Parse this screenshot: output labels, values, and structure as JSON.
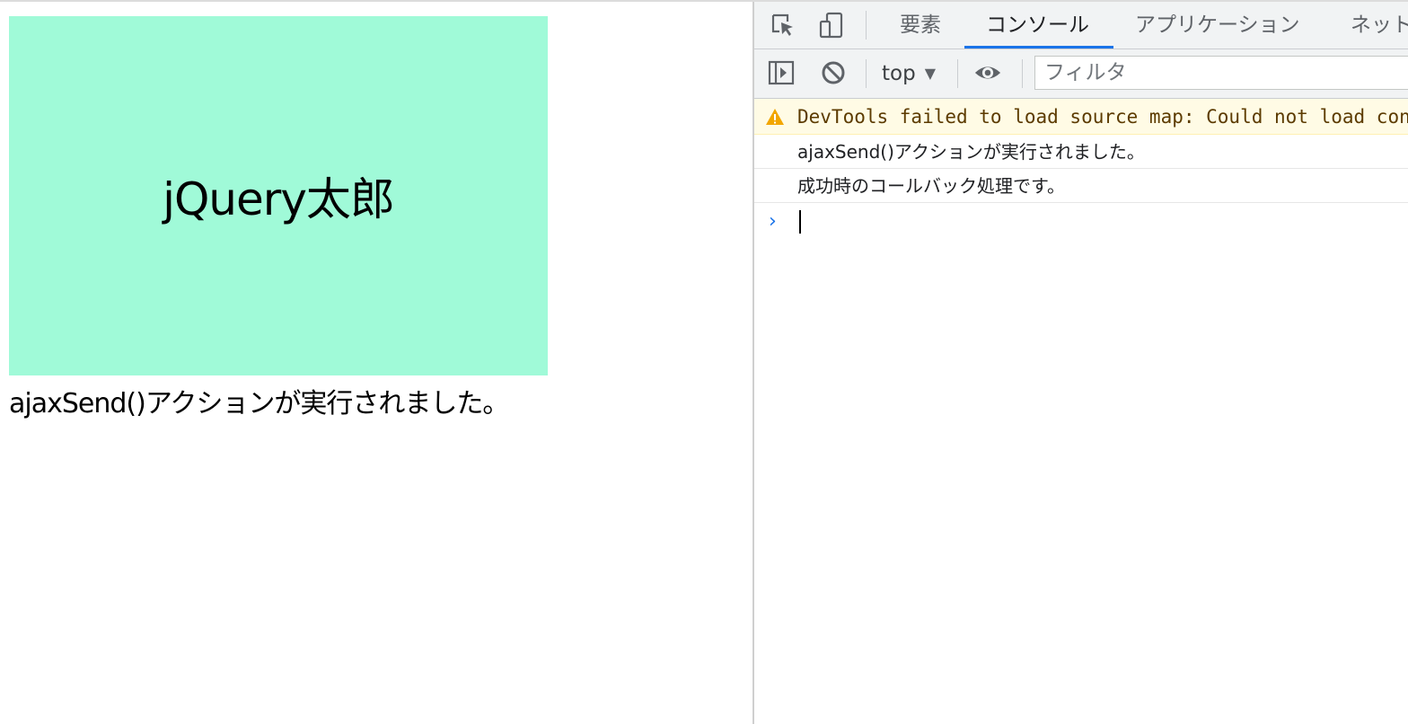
{
  "page": {
    "box_text": "jQuery太郎",
    "box_color": "#a0fad8",
    "message": "ajaxSend()アクションが実行されました。"
  },
  "devtools": {
    "tabs": [
      {
        "label": "要素",
        "active": false
      },
      {
        "label": "コンソール",
        "active": true
      },
      {
        "label": "アプリケーション",
        "active": false
      },
      {
        "label": "ネット",
        "active": false
      }
    ],
    "toolbar_icons": [
      "inspect-element-icon",
      "device-toggle-icon",
      "sidebar-toggle-icon",
      "clear-console-icon",
      "eye-icon"
    ],
    "context": "top",
    "filter_placeholder": "フィルタ",
    "accent_color": "#1a73e8",
    "messages": [
      {
        "level": "warning",
        "icon": "warning-icon",
        "text": "DevTools failed to load source map: Could not load content"
      },
      {
        "level": "log",
        "text": "ajaxSend()アクションが実行されました。"
      },
      {
        "level": "log",
        "text": "成功時のコールバック処理です。"
      }
    ],
    "prompt_symbol": "›"
  }
}
